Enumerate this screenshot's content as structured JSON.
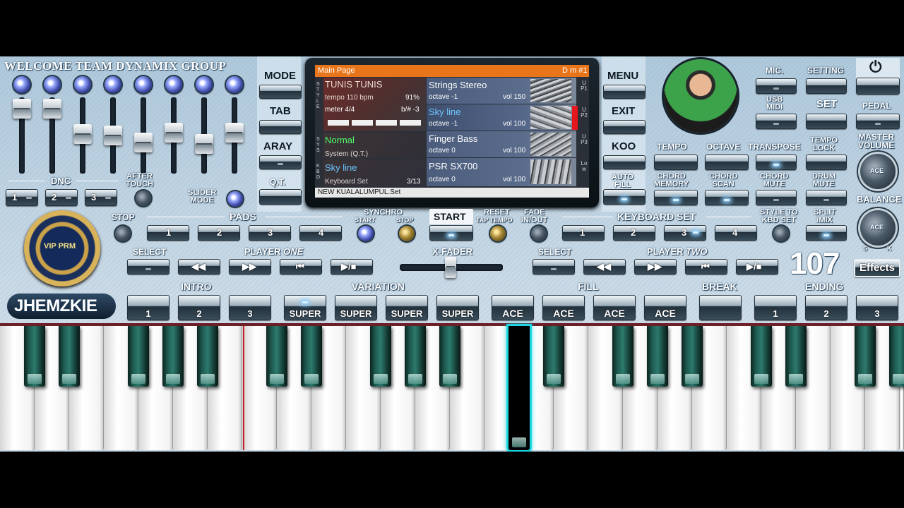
{
  "header": {
    "group_title": "WELCOME  TEAM  DYNAMIX  GROUP"
  },
  "left_panel": {
    "dnc_label": "DNC",
    "dnc_buttons": [
      "1",
      "2",
      "3"
    ],
    "after_touch": "AFTER\nTOUCH",
    "slider_mode": "SLIDER\nMODE",
    "stop_label": "STOP",
    "logo_text": "VIP PRM",
    "brand": "JHEMZKIE"
  },
  "side_left": {
    "mode": "MODE",
    "tab": "TAB",
    "aray": "ARAY",
    "qt": "Q.T."
  },
  "side_right": {
    "menu": "MENU",
    "exit": "EXIT",
    "koo": "KOO",
    "auto_fill": "AUTO\nFILL"
  },
  "screen": {
    "title": "Main Page",
    "dm": "D m #1",
    "style_name": "TUNIS TUNIS",
    "tempo": "tempo 110 bpm",
    "tempo_pct": "91%",
    "meter": "meter 4/4",
    "transpose_info": "b/# -3",
    "beats_lit": 4,
    "system_name": "Normal",
    "system_sub": "System (Q.T.)",
    "kbd_name": "Sky line",
    "kbd_sub": "Keyboard Set",
    "kbd_count": "3/13",
    "side_style": "STYLE",
    "side_sys": "SYS",
    "side_kbd": "KBD",
    "parts": [
      {
        "name": "Strings Stereo",
        "octave": "octave -1",
        "vol": "vol 150",
        "tag": "UP1"
      },
      {
        "name": "Sky line",
        "octave": "octave -1",
        "vol": "vol 100",
        "tag": "UP2"
      },
      {
        "name": "Finger Bass",
        "octave": "octave 0",
        "vol": "vol 100",
        "tag": "UP3"
      },
      {
        "name": "PSR SX700",
        "octave": "octave 0",
        "vol": "vol 100",
        "tag": "Low"
      }
    ],
    "footer": "NEW KUALALUMPUL.Set"
  },
  "right_panel": {
    "mic": "MIC.",
    "setting": "SETTING",
    "usb_midi": "USB\nMIDI",
    "set": "SET",
    "pedal": "PEDAL",
    "master_volume": "MASTER\nVOLUME",
    "tempo": "TEMPO",
    "octave": "OCTAVE",
    "transpose": "TRANSPOSE",
    "tempo_lock": "TEMPO\nLOCK",
    "chord_memory": "CHORD\nMEMORY",
    "chord_scan": "CHORD\nSCAN",
    "chord_mute": "CHORD\nMUTE",
    "drum_mute": "DRUM\nMUTE",
    "balance": "BALANCE",
    "balance_s": "S",
    "balance_k": "K",
    "knob_logo": "ACE",
    "effects": "Effects",
    "tempo_value": "107"
  },
  "middle_row": {
    "pads": "PADS",
    "pad_buttons": [
      "1",
      "2",
      "3",
      "4"
    ],
    "synchro": "SYNCHRO",
    "synchro_start": "START",
    "synchro_stop": "STOP",
    "start": "START",
    "reset": "RESET",
    "tap_tempo": "TAP TEMPO",
    "fade": "FADE\nIN/OUT",
    "keyboard_set": "KEYBOARD SET",
    "kbd_buttons": [
      "1",
      "2",
      "3",
      "4"
    ],
    "style_to_kbd": "STYLE TO\nKBD SET",
    "split_mix": "SPLIT\n/MIX",
    "select_1": "SELECT",
    "player_one_a": "PLAYER ",
    "player_one_b": "ONE",
    "x_fader": "X-FADER",
    "select_2": "SELECT",
    "player_two_a": "PLAYER ",
    "player_two_b": "TWO"
  },
  "bottom_row": {
    "intro": "INTRO",
    "intro_buttons": [
      "1",
      "2",
      "3"
    ],
    "variation": "VARIATION",
    "variation_buttons": [
      "SUPER",
      "SUPER",
      "SUPER",
      "SUPER"
    ],
    "fill": "FILL",
    "fill_buttons": [
      "ACE",
      "ACE",
      "ACE",
      "ACE"
    ],
    "break": "BREAK",
    "ending": "ENDING",
    "ending_buttons": [
      "1",
      "2",
      "3"
    ]
  },
  "colors": {
    "accent": "#e8751a",
    "screen_bg": "#2a2f38",
    "key_pressed": "#19d6e0"
  }
}
